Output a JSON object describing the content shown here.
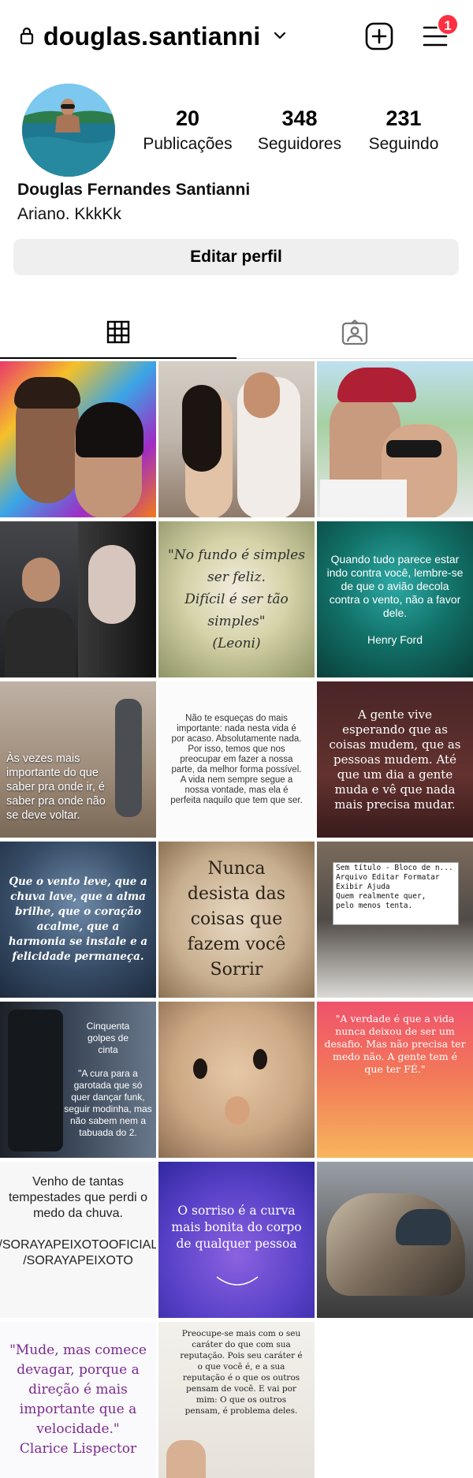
{
  "profile": {
    "username": "douglas.santianni",
    "notification_count": "1",
    "stats": [
      {
        "value": "20",
        "label": "Publicações"
      },
      {
        "value": "348",
        "label": "Seguidores"
      },
      {
        "value": "231",
        "label": "Seguindo"
      }
    ],
    "full_name": "Douglas Fernandes Santianni",
    "bio": "Ariano. KkkKk",
    "edit_button": "Editar perfil"
  },
  "icons": {
    "lock": "lock-icon",
    "chevron": "chevron-down-icon",
    "add": "add-post-icon",
    "menu": "menu-icon",
    "grid": "grid-icon",
    "tagged": "tagged-icon"
  },
  "posts": [
    {
      "text": ""
    },
    {
      "text": ""
    },
    {
      "text": ""
    },
    {
      "text": ""
    },
    {
      "text": "\"No fundo é simples ser feliz.\nDifícil é ser tão simples\"\n(Leoni)"
    },
    {
      "text": "Quando tudo parece estar indo contra você, lembre-se de que o avião decola contra o vento, não a favor dele.\n\nHenry Ford"
    },
    {
      "text": "Às vezes mais importante do que saber pra onde ir, é saber pra onde não se deve voltar."
    },
    {
      "text": "Não te esqueças do mais importante: nada nesta vida é por acaso. Absolutamente nada. Por isso, temos que nos preocupar em fazer a nossa parte, da melhor forma possível.\nA vida nem sempre segue a nossa vontade, mas ela é perfeita naquilo que tem que ser."
    },
    {
      "text": "A gente vive esperando que as coisas mudem, que as pessoas mudem. Até que um dia a gente muda e vê que nada mais precisa mudar."
    },
    {
      "text": "Que o vento leve, que a chuva lave, que a alma brilhe, que o coração acalme, que a harmonia se instale e a felicidade permaneça."
    },
    {
      "text": "Nunca\ndesista das\ncoisas que\nfazem você\nSorrir"
    },
    {
      "text": "Sem título - Bloco de n...\nArquivo  Editar  Formatar  Exibir  Ajuda\nQuem realmente quer,\npelo menos tenta."
    },
    {
      "text": "Cinquenta\ngolpes de\ncinta\n\n\"A cura para a garotada que só quer dançar funk, seguir modinha, mas não sabem nem a tabuada do 2."
    },
    {
      "text": ""
    },
    {
      "text": "\"A verdade é que a vida nunca deixou de ser um desafio. Mas não precisa ter medo não. A gente tem é que ter FÉ.\""
    },
    {
      "text": "Venho de tantas tempestades que perdi o medo da chuva.\n\n/SORAYAPEIXOTOOFICIAL   /SORAYAPEIXOTO"
    },
    {
      "text": "O sorriso é a curva mais bonita do corpo de qualquer pessoa"
    },
    {
      "text": ""
    },
    {
      "text": "\"Mude, mas comece devagar, porque a direção é mais importante que a velocidade.\"\nClarice Lispector"
    },
    {
      "text": "Preocupe-se mais com o seu caráter do que com sua reputação. Pois seu caráter é o que você é, e a sua reputação é o que os outros pensam de você. E vai por mim: O que os outros pensam, é problema deles."
    }
  ]
}
